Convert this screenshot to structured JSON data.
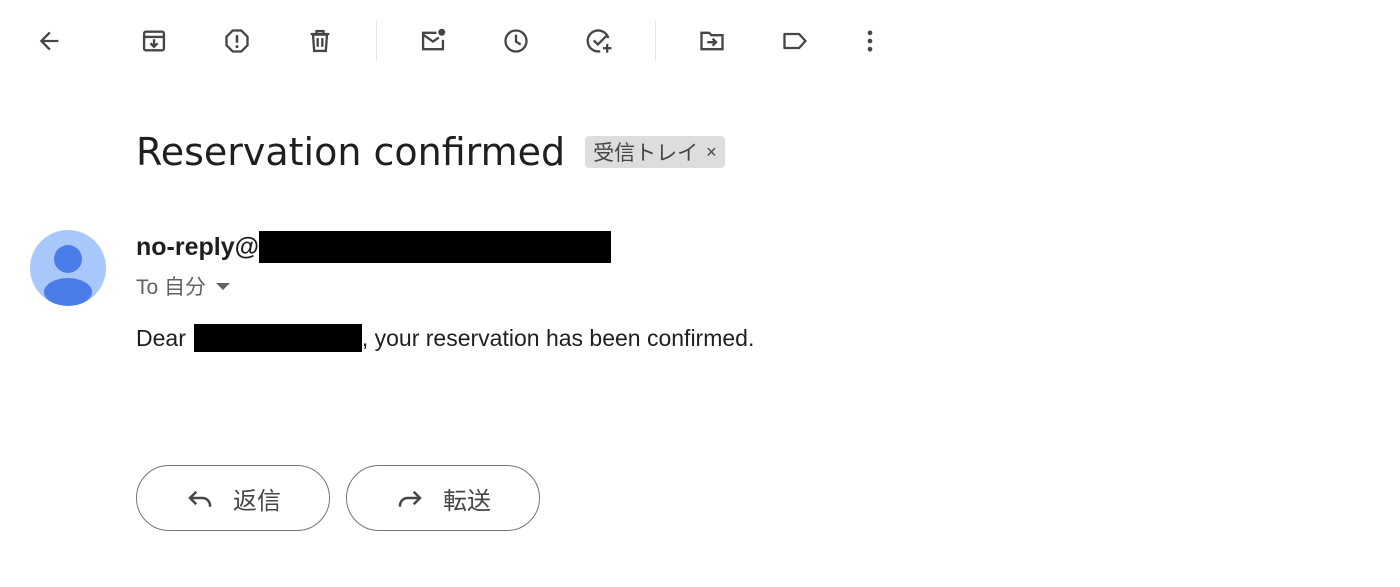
{
  "toolbar": {
    "buttons": [
      {
        "name": "back-button",
        "icon": "arrow-left-icon"
      },
      {
        "name": "archive-button",
        "icon": "archive-icon"
      },
      {
        "name": "report-spam-button",
        "icon": "report-icon"
      },
      {
        "name": "delete-button",
        "icon": "trash-icon"
      },
      {
        "name": "mark-unread-button",
        "icon": "mark-unread-icon"
      },
      {
        "name": "snooze-button",
        "icon": "clock-icon"
      },
      {
        "name": "add-task-button",
        "icon": "add-task-icon"
      },
      {
        "name": "move-to-button",
        "icon": "folder-move-icon"
      },
      {
        "name": "label-button",
        "icon": "label-icon"
      },
      {
        "name": "more-button",
        "icon": "more-vert-icon"
      }
    ]
  },
  "email": {
    "subject": "Reservation confirmed",
    "label_chip": {
      "text": "受信トレイ",
      "remove": "×"
    },
    "sender_prefix": "no-reply@",
    "to_text": "To 自分",
    "body_prefix": "Dear",
    "body_suffix": ", your reservation has been confirmed."
  },
  "actions": {
    "reply_label": "返信",
    "forward_label": "転送"
  },
  "colors": {
    "avatar_bg": "#a8c7fa",
    "avatar_figure": "#4a7de8",
    "icon": "#444746",
    "chip_bg": "#dddddd"
  }
}
